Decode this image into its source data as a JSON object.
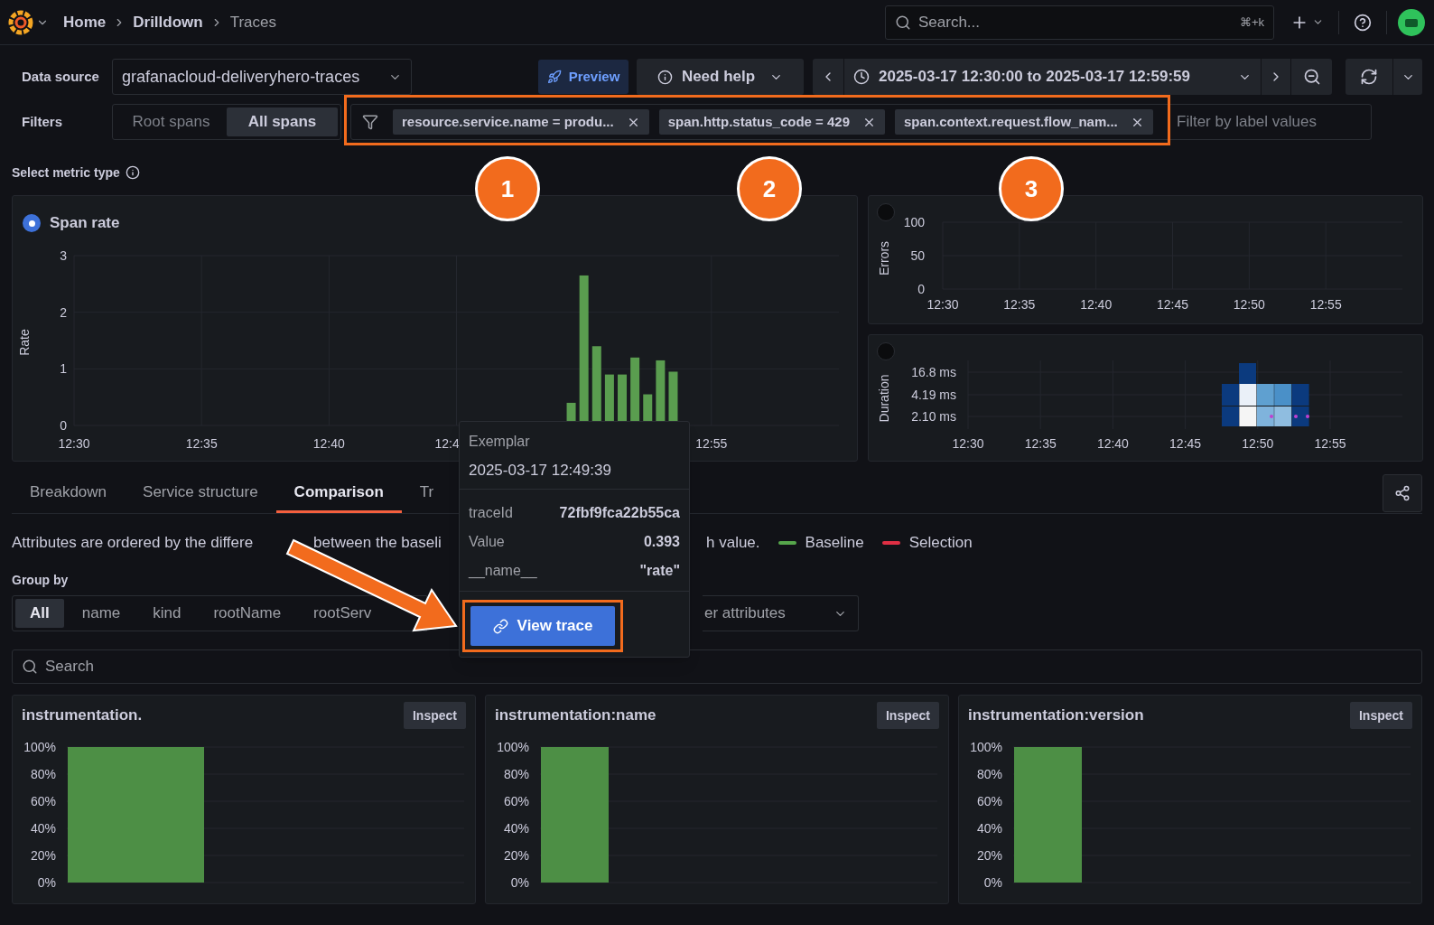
{
  "top_bar": {
    "breadcrumbs": [
      {
        "label": "Home",
        "current": false
      },
      {
        "label": "Drilldown",
        "current": false
      },
      {
        "label": "Traces",
        "current": true
      }
    ],
    "search": {
      "placeholder": "Search...",
      "shortcut": "⌘+k"
    }
  },
  "toolbar": {
    "data_source_label": "Data source",
    "data_source": "grafanacloud-deliveryhero-traces",
    "preview": "Preview",
    "need_help": "Need help",
    "time_range": "2025-03-17 12:30:00 to 2025-03-17 12:59:59"
  },
  "filters": {
    "label": "Filters",
    "span_modes": [
      {
        "label": "Root spans",
        "selected": false
      },
      {
        "label": "All spans",
        "selected": true
      }
    ],
    "chips": [
      "resource.service.name = produ...",
      "span.http.status_code = 429",
      "span.context.request.flow_nam..."
    ],
    "placeholder": "Filter by label values"
  },
  "callouts": [
    "1",
    "2",
    "3"
  ],
  "metric_type": {
    "label": "Select metric type"
  },
  "panels": [
    {
      "kind": "rate",
      "title": "Span rate",
      "selected": true,
      "chart_data": {
        "type": "bar",
        "ylabel": "Rate",
        "grid": true,
        "ylim": [
          0,
          3
        ],
        "yticks": [
          0,
          1,
          2,
          3
        ],
        "categories": [
          "12:30",
          null,
          null,
          null,
          null,
          null,
          null,
          null,
          null,
          null,
          "12:35",
          null,
          null,
          null,
          null,
          null,
          null,
          null,
          null,
          null,
          "12:40",
          null,
          null,
          null,
          null,
          null,
          null,
          null,
          null,
          null,
          "12:4",
          null,
          null,
          null,
          null,
          null,
          null,
          null,
          null,
          null,
          null,
          null,
          null,
          null,
          null,
          null,
          null,
          null,
          null,
          null,
          "12:55",
          null,
          null,
          null,
          null,
          null,
          null,
          null,
          null,
          null
        ],
        "values": [
          null,
          null,
          null,
          null,
          null,
          null,
          null,
          null,
          null,
          null,
          null,
          null,
          null,
          null,
          null,
          null,
          null,
          null,
          null,
          null,
          null,
          null,
          null,
          null,
          null,
          null,
          null,
          null,
          null,
          null,
          null,
          null,
          null,
          null,
          null,
          null,
          null,
          null,
          null,
          0.4,
          2.65,
          1.4,
          0.9,
          0.9,
          1.2,
          0.55,
          1.15,
          0.95,
          null,
          null,
          null,
          null,
          null,
          null,
          null,
          null,
          null,
          null,
          null,
          null
        ]
      }
    },
    {
      "kind": "errors",
      "selected": false,
      "chart_data": {
        "type": "line",
        "ylabel": "Errors",
        "grid": true,
        "ylim": [
          0,
          100
        ],
        "yticks": [
          0,
          50,
          100
        ],
        "categories": [
          "12:30",
          null,
          null,
          null,
          null,
          "12:35",
          null,
          null,
          null,
          null,
          "12:40",
          null,
          null,
          null,
          null,
          "12:45",
          null,
          null,
          null,
          null,
          "12:50",
          null,
          null,
          null,
          null,
          "12:55",
          null,
          null,
          null,
          null
        ]
      }
    },
    {
      "kind": "duration",
      "selected": false,
      "ylabel": "Duration",
      "y_labels": [
        "16.8 ms",
        "4.19 ms",
        "2.10 ms"
      ],
      "x_labels": [
        "12:30",
        "12:35",
        "12:40",
        "12:45",
        "12:50",
        "12:55"
      ]
    }
  ],
  "tabs": [
    {
      "label": "Breakdown",
      "selected": false
    },
    {
      "label": "Service structure",
      "selected": false
    },
    {
      "label": "Comparison",
      "selected": true
    },
    {
      "label": "Tr",
      "selected": false
    }
  ],
  "description": {
    "parts": [
      "Attributes are ordered by the differe",
      "between the baseli",
      "h value."
    ],
    "legend": [
      {
        "label": "Baseline",
        "color": "#56a64b"
      },
      {
        "label": "Selection",
        "color": "#e02f44"
      }
    ]
  },
  "group_by": {
    "label": "Group by",
    "options": [
      {
        "label": "All",
        "selected": true
      },
      {
        "label": "name",
        "selected": false
      },
      {
        "label": "kind",
        "selected": false
      },
      {
        "label": "rootName",
        "selected": false
      },
      {
        "label": "rootServ",
        "selected": false
      }
    ],
    "dropdown": "er attributes"
  },
  "search": {
    "placeholder": "Search"
  },
  "cards": [
    {
      "title": "instrumentation.",
      "button": "Inspect",
      "chart_data": {
        "type": "bar",
        "grid": true,
        "values": [
          100
        ],
        "ylim": [
          0,
          100
        ],
        "yticks": [
          {
            "value": 0,
            "label": "0%"
          },
          {
            "value": 20,
            "label": "20%"
          },
          {
            "value": 40,
            "label": "40%"
          },
          {
            "value": 60,
            "label": "60%"
          },
          {
            "value": 80,
            "label": "80%"
          },
          {
            "value": 100,
            "label": "100%"
          }
        ]
      }
    },
    {
      "title": "instrumentation:name",
      "button": "Inspect",
      "chart_data": {
        "type": "bar",
        "grid": true,
        "values": [
          100
        ],
        "ylim": [
          0,
          100
        ],
        "yticks": [
          {
            "value": 0,
            "label": "0%"
          },
          {
            "value": 20,
            "label": "20%"
          },
          {
            "value": 40,
            "label": "40%"
          },
          {
            "value": 60,
            "label": "60%"
          },
          {
            "value": 80,
            "label": "80%"
          },
          {
            "value": 100,
            "label": "100%"
          }
        ]
      }
    },
    {
      "title": "instrumentation:version",
      "button": "Inspect",
      "chart_data": {
        "type": "bar",
        "grid": true,
        "values": [
          100
        ],
        "ylim": [
          0,
          100
        ],
        "yticks": [
          {
            "value": 0,
            "label": "0%"
          },
          {
            "value": 20,
            "label": "20%"
          },
          {
            "value": 40,
            "label": "40%"
          },
          {
            "value": 60,
            "label": "60%"
          },
          {
            "value": 80,
            "label": "80%"
          },
          {
            "value": 100,
            "label": "100%"
          }
        ]
      }
    }
  ],
  "tooltip": {
    "title": "Exemplar",
    "time": "2025-03-17 12:49:39",
    "rows": [
      {
        "key": "traceId",
        "value": "72fbf9fca22b55ca"
      },
      {
        "key": "Value",
        "value": "0.393"
      },
      {
        "key": "__name__",
        "value": "\"rate\""
      }
    ],
    "button": "View trace"
  }
}
